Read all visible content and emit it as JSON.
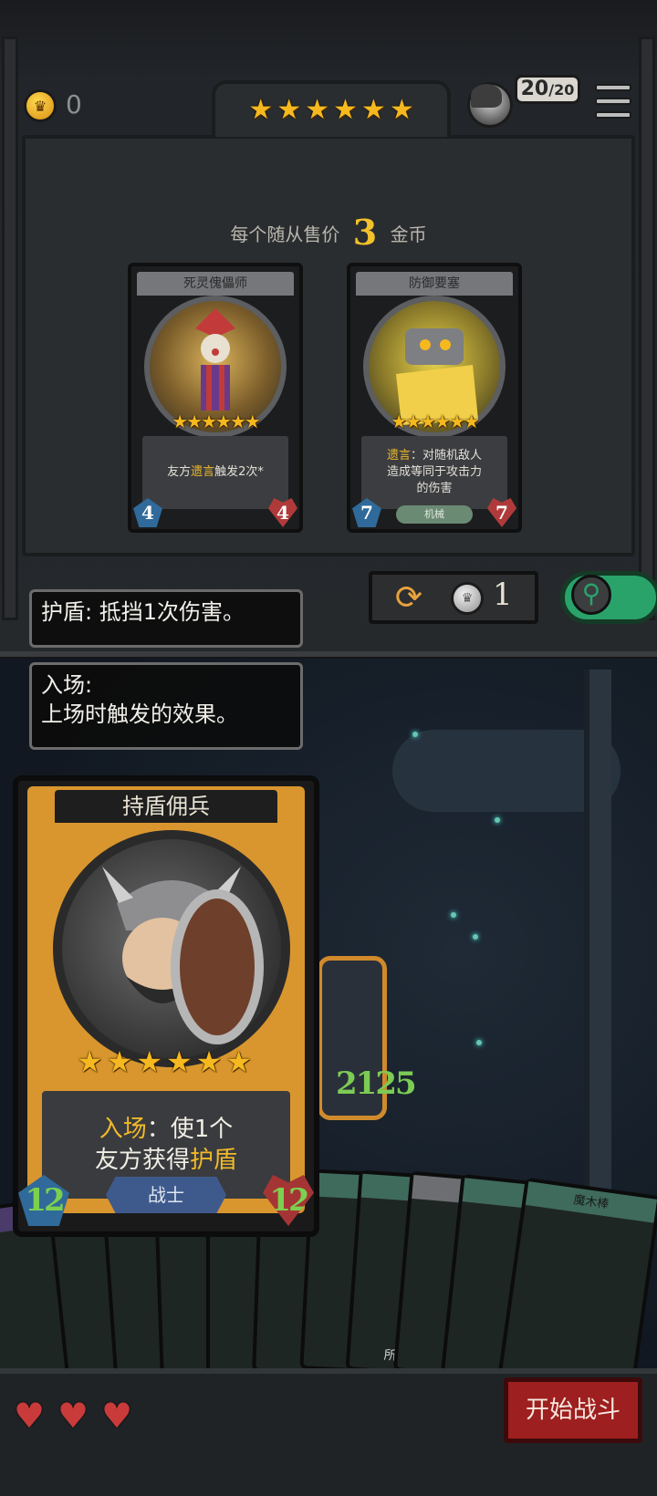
{
  "header": {
    "gold_count": "0",
    "tier_stars": 6,
    "population": {
      "current": "20",
      "max": "/20"
    }
  },
  "shop": {
    "sell_prefix": "每个随从售价",
    "sell_price": "3",
    "sell_suffix": "金币",
    "cards": [
      {
        "name": "死灵傀儡师",
        "stars": 6,
        "desc_parts": [
          "友方",
          "遗言",
          "触发2次*"
        ],
        "attack": "4",
        "health": "4",
        "tribe": ""
      },
      {
        "name": "防御要塞",
        "stars": 6,
        "desc_parts": [
          "遗言",
          "：对随机敌人",
          "造成等同于攻击力",
          "的伤害"
        ],
        "attack": "7",
        "health": "7",
        "tribe": "机械"
      }
    ],
    "refresh_cost": "1"
  },
  "tooltips": {
    "shield": "护盾: 抵挡1次伤害。",
    "entry_title": "入场:",
    "entry_body": "上场时触发的效果。"
  },
  "board": {
    "enemy_stats": "2125"
  },
  "hovered_card": {
    "name": "持盾佣兵",
    "stars": 6,
    "desc_line1_kw": "入场",
    "desc_line1_rest": "：使1个",
    "desc_line2_pre": "友方获得",
    "desc_line2_kw": "护盾",
    "tribe": "战士",
    "attack": "12",
    "health": "12"
  },
  "hand": {
    "left_card_label": "魔木",
    "right_card_label": "魔木棒",
    "partial_text": "所有"
  },
  "footer": {
    "hearts": 3,
    "start_battle": "开始战斗"
  },
  "colors": {
    "gold": "#f5b91f",
    "keyword": "#f1b92a",
    "attack_blue": "#2f6a9a",
    "health_red": "#b03a3a",
    "buff_green": "#7cd050",
    "start_red": "#9e1f1f"
  }
}
